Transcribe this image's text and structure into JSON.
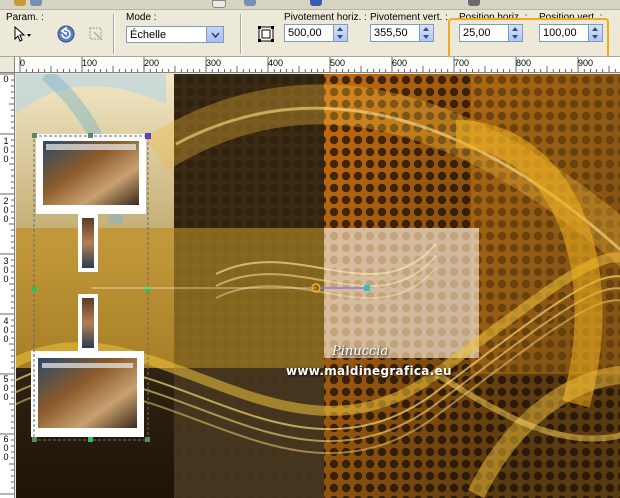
{
  "toolbar": {
    "param_label": "Param. :",
    "mode_label": "Mode :",
    "mode_value": "Échelle",
    "rot_h_label": "Pivotement horiz. :",
    "rot_h_value": "500,00",
    "rot_v_label": "Pivotement vert. :",
    "rot_v_value": "355,50",
    "pos_h_label": "Position horiz. :",
    "pos_h_value": "25,00",
    "pos_v_label": "Position vert. :",
    "pos_v_value": "100,00"
  },
  "ruler": {
    "h_labels": [
      "0",
      "100",
      "200",
      "300",
      "400",
      "500",
      "600",
      "700",
      "800",
      "900"
    ],
    "v_labels": [
      "0",
      "1\n0\n0",
      "2\n0\n0",
      "3\n0\n0",
      "4\n0\n0",
      "5\n0\n0",
      "6\n0\n0"
    ]
  },
  "watermark": {
    "line1": "Pinuccia",
    "line2": "www.maldinegrafica.eu"
  },
  "colors": {
    "highlight": "#f2a81b",
    "handle_green": "#2fbf5a",
    "handle_teal": "#2ec4b6",
    "handle_purple": "#5a3fbf"
  },
  "icons": {
    "param": "arrow-cursor-icon",
    "reset": "reset-icon",
    "apply": "apply-transform-icon",
    "deform": "deform-frame-icon"
  }
}
